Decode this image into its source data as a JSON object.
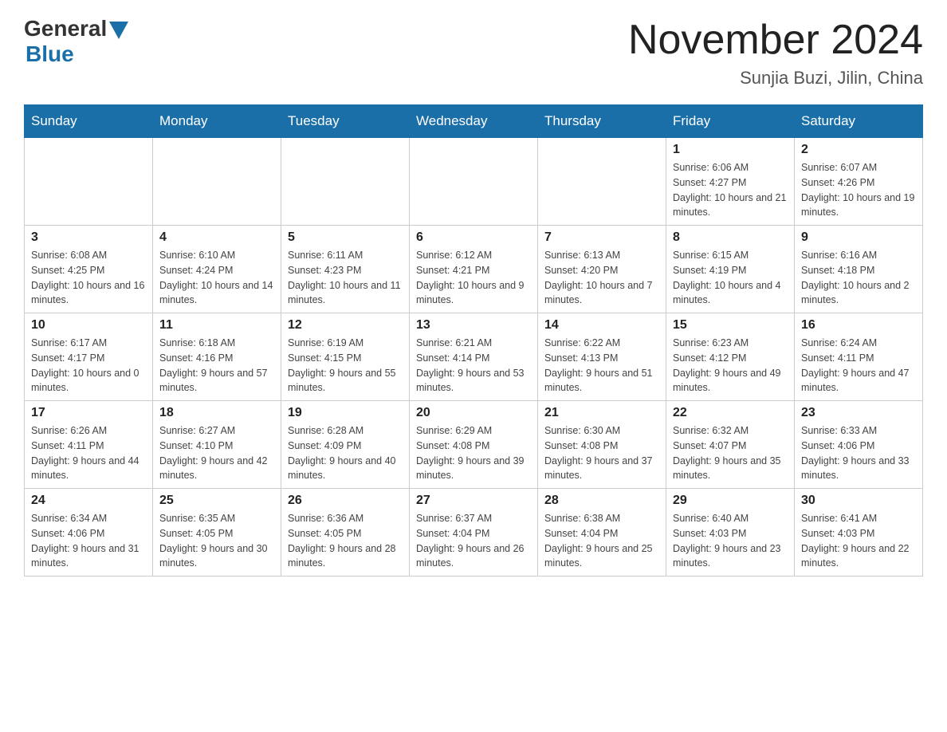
{
  "header": {
    "logo_general": "General",
    "logo_blue": "Blue",
    "month_title": "November 2024",
    "location": "Sunjia Buzi, Jilin, China"
  },
  "weekdays": [
    "Sunday",
    "Monday",
    "Tuesday",
    "Wednesday",
    "Thursday",
    "Friday",
    "Saturday"
  ],
  "weeks": [
    [
      {
        "day": "",
        "sunrise": "",
        "sunset": "",
        "daylight": ""
      },
      {
        "day": "",
        "sunrise": "",
        "sunset": "",
        "daylight": ""
      },
      {
        "day": "",
        "sunrise": "",
        "sunset": "",
        "daylight": ""
      },
      {
        "day": "",
        "sunrise": "",
        "sunset": "",
        "daylight": ""
      },
      {
        "day": "",
        "sunrise": "",
        "sunset": "",
        "daylight": ""
      },
      {
        "day": "1",
        "sunrise": "Sunrise: 6:06 AM",
        "sunset": "Sunset: 4:27 PM",
        "daylight": "Daylight: 10 hours and 21 minutes."
      },
      {
        "day": "2",
        "sunrise": "Sunrise: 6:07 AM",
        "sunset": "Sunset: 4:26 PM",
        "daylight": "Daylight: 10 hours and 19 minutes."
      }
    ],
    [
      {
        "day": "3",
        "sunrise": "Sunrise: 6:08 AM",
        "sunset": "Sunset: 4:25 PM",
        "daylight": "Daylight: 10 hours and 16 minutes."
      },
      {
        "day": "4",
        "sunrise": "Sunrise: 6:10 AM",
        "sunset": "Sunset: 4:24 PM",
        "daylight": "Daylight: 10 hours and 14 minutes."
      },
      {
        "day": "5",
        "sunrise": "Sunrise: 6:11 AM",
        "sunset": "Sunset: 4:23 PM",
        "daylight": "Daylight: 10 hours and 11 minutes."
      },
      {
        "day": "6",
        "sunrise": "Sunrise: 6:12 AM",
        "sunset": "Sunset: 4:21 PM",
        "daylight": "Daylight: 10 hours and 9 minutes."
      },
      {
        "day": "7",
        "sunrise": "Sunrise: 6:13 AM",
        "sunset": "Sunset: 4:20 PM",
        "daylight": "Daylight: 10 hours and 7 minutes."
      },
      {
        "day": "8",
        "sunrise": "Sunrise: 6:15 AM",
        "sunset": "Sunset: 4:19 PM",
        "daylight": "Daylight: 10 hours and 4 minutes."
      },
      {
        "day": "9",
        "sunrise": "Sunrise: 6:16 AM",
        "sunset": "Sunset: 4:18 PM",
        "daylight": "Daylight: 10 hours and 2 minutes."
      }
    ],
    [
      {
        "day": "10",
        "sunrise": "Sunrise: 6:17 AM",
        "sunset": "Sunset: 4:17 PM",
        "daylight": "Daylight: 10 hours and 0 minutes."
      },
      {
        "day": "11",
        "sunrise": "Sunrise: 6:18 AM",
        "sunset": "Sunset: 4:16 PM",
        "daylight": "Daylight: 9 hours and 57 minutes."
      },
      {
        "day": "12",
        "sunrise": "Sunrise: 6:19 AM",
        "sunset": "Sunset: 4:15 PM",
        "daylight": "Daylight: 9 hours and 55 minutes."
      },
      {
        "day": "13",
        "sunrise": "Sunrise: 6:21 AM",
        "sunset": "Sunset: 4:14 PM",
        "daylight": "Daylight: 9 hours and 53 minutes."
      },
      {
        "day": "14",
        "sunrise": "Sunrise: 6:22 AM",
        "sunset": "Sunset: 4:13 PM",
        "daylight": "Daylight: 9 hours and 51 minutes."
      },
      {
        "day": "15",
        "sunrise": "Sunrise: 6:23 AM",
        "sunset": "Sunset: 4:12 PM",
        "daylight": "Daylight: 9 hours and 49 minutes."
      },
      {
        "day": "16",
        "sunrise": "Sunrise: 6:24 AM",
        "sunset": "Sunset: 4:11 PM",
        "daylight": "Daylight: 9 hours and 47 minutes."
      }
    ],
    [
      {
        "day": "17",
        "sunrise": "Sunrise: 6:26 AM",
        "sunset": "Sunset: 4:11 PM",
        "daylight": "Daylight: 9 hours and 44 minutes."
      },
      {
        "day": "18",
        "sunrise": "Sunrise: 6:27 AM",
        "sunset": "Sunset: 4:10 PM",
        "daylight": "Daylight: 9 hours and 42 minutes."
      },
      {
        "day": "19",
        "sunrise": "Sunrise: 6:28 AM",
        "sunset": "Sunset: 4:09 PM",
        "daylight": "Daylight: 9 hours and 40 minutes."
      },
      {
        "day": "20",
        "sunrise": "Sunrise: 6:29 AM",
        "sunset": "Sunset: 4:08 PM",
        "daylight": "Daylight: 9 hours and 39 minutes."
      },
      {
        "day": "21",
        "sunrise": "Sunrise: 6:30 AM",
        "sunset": "Sunset: 4:08 PM",
        "daylight": "Daylight: 9 hours and 37 minutes."
      },
      {
        "day": "22",
        "sunrise": "Sunrise: 6:32 AM",
        "sunset": "Sunset: 4:07 PM",
        "daylight": "Daylight: 9 hours and 35 minutes."
      },
      {
        "day": "23",
        "sunrise": "Sunrise: 6:33 AM",
        "sunset": "Sunset: 4:06 PM",
        "daylight": "Daylight: 9 hours and 33 minutes."
      }
    ],
    [
      {
        "day": "24",
        "sunrise": "Sunrise: 6:34 AM",
        "sunset": "Sunset: 4:06 PM",
        "daylight": "Daylight: 9 hours and 31 minutes."
      },
      {
        "day": "25",
        "sunrise": "Sunrise: 6:35 AM",
        "sunset": "Sunset: 4:05 PM",
        "daylight": "Daylight: 9 hours and 30 minutes."
      },
      {
        "day": "26",
        "sunrise": "Sunrise: 6:36 AM",
        "sunset": "Sunset: 4:05 PM",
        "daylight": "Daylight: 9 hours and 28 minutes."
      },
      {
        "day": "27",
        "sunrise": "Sunrise: 6:37 AM",
        "sunset": "Sunset: 4:04 PM",
        "daylight": "Daylight: 9 hours and 26 minutes."
      },
      {
        "day": "28",
        "sunrise": "Sunrise: 6:38 AM",
        "sunset": "Sunset: 4:04 PM",
        "daylight": "Daylight: 9 hours and 25 minutes."
      },
      {
        "day": "29",
        "sunrise": "Sunrise: 6:40 AM",
        "sunset": "Sunset: 4:03 PM",
        "daylight": "Daylight: 9 hours and 23 minutes."
      },
      {
        "day": "30",
        "sunrise": "Sunrise: 6:41 AM",
        "sunset": "Sunset: 4:03 PM",
        "daylight": "Daylight: 9 hours and 22 minutes."
      }
    ]
  ]
}
